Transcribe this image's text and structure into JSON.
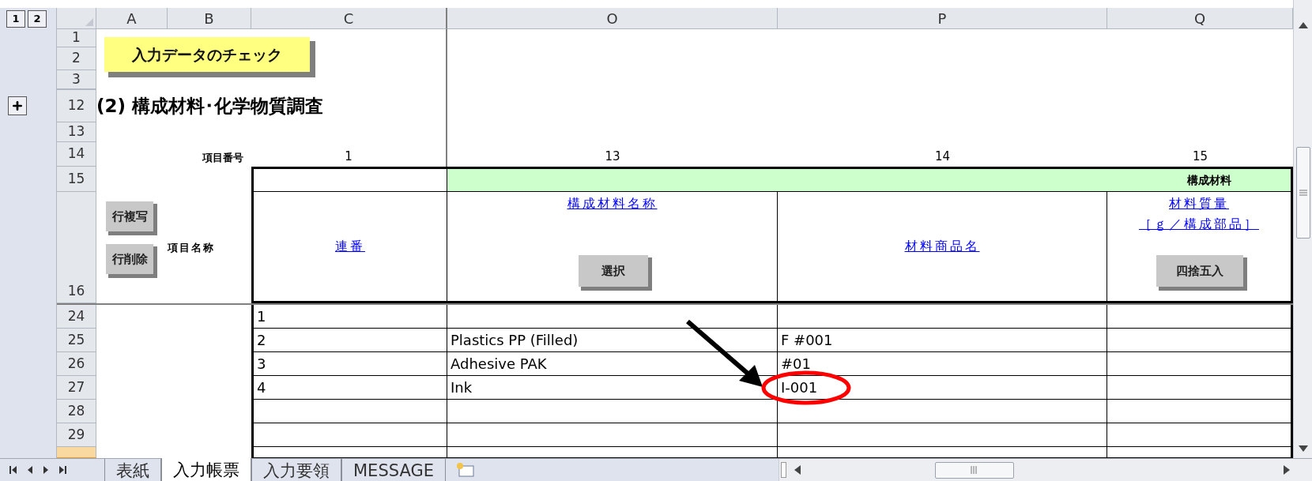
{
  "outline": {
    "levels": [
      "1",
      "2"
    ]
  },
  "column_headers": [
    "A",
    "B",
    "C",
    "O",
    "P",
    "Q"
  ],
  "top_row_numbers": [
    "1",
    "2",
    "3",
    "12",
    "13",
    "14",
    "15",
    "16"
  ],
  "check_button": "入力データのチェック",
  "section_title": "(2) 構成材料･化学物質調査",
  "item_number_label": "項目番号",
  "item_numbers": [
    "1",
    "13",
    "14",
    "15"
  ],
  "group_header": "構成材料",
  "item_name_label": "項目名称",
  "row_buttons": [
    "行複写",
    "行削除"
  ],
  "field_headers": [
    {
      "lines": [
        "連番"
      ]
    },
    {
      "lines": [
        "構成材料名称"
      ],
      "button": "選択"
    },
    {
      "lines": [
        "材料商品名"
      ]
    },
    {
      "lines": [
        "材料質量",
        "［ｇ／構成部品］"
      ],
      "button": "四捨五入"
    }
  ],
  "rows": [
    {
      "kind": "full",
      "row": "24",
      "selected": false,
      "seq": "1"
    },
    {
      "kind": "full",
      "row": "25",
      "selected": false,
      "seq": "2",
      "material": "Plastics PP (Filled)",
      "trade_name": "F #001"
    },
    {
      "kind": "full",
      "row": "26",
      "selected": false,
      "seq": "3",
      "material": "Adhesive PAK",
      "trade_name": "#01"
    },
    {
      "kind": "full",
      "row": "27",
      "selected": false,
      "seq": "4",
      "material": "Ink",
      "trade_name": "I-001"
    },
    {
      "kind": "full",
      "row": "28",
      "selected": false
    },
    {
      "kind": "full",
      "row": "29",
      "selected": false
    },
    {
      "kind": "partial",
      "selected": true
    }
  ],
  "sheet_tabs": [
    {
      "label": "表紙",
      "selected": false
    },
    {
      "label": "入力帳票",
      "selected": true
    },
    {
      "label": "入力要領",
      "selected": false
    },
    {
      "label": "MESSAGE",
      "selected": false
    }
  ]
}
